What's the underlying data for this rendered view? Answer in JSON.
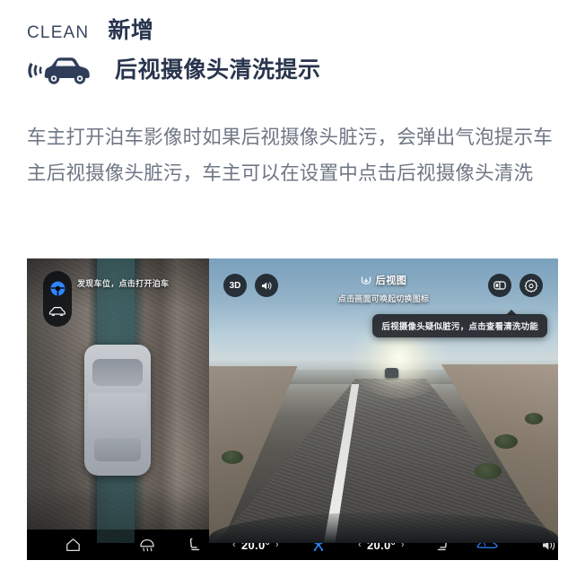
{
  "header": {
    "kicker": "CLEAN",
    "tag": "新增",
    "title": "后视摄像头清洗提示",
    "icon": "car-sonar-icon",
    "color": "#29354d"
  },
  "body": {
    "paragraph": "车主打开泊车影像时如果后视摄像头脏污，会弹出气泡提示车主后视摄像头脏污，车主可以在设置中点击后视摄像头清洗",
    "color": "#6f7785"
  },
  "screenshot": {
    "left_panel": {
      "hint_text": "发现车位，点击打开泊车",
      "controls": [
        {
          "name": "steering-wheel-icon",
          "color": "#2f86ff"
        },
        {
          "name": "car-top-icon",
          "color": "#ffffff"
        }
      ]
    },
    "right_panel": {
      "title": "后视图",
      "subtitle": "点击画面可唤起切换图标",
      "title_icon": "rear-view-icon",
      "buttons": [
        {
          "name": "3d-button",
          "label": "3D"
        },
        {
          "name": "volume-button",
          "label": ""
        },
        {
          "name": "split-view-button",
          "label": ""
        },
        {
          "name": "settings-button",
          "label": ""
        }
      ],
      "tooltip": "后视摄像头疑似脏污，点击查看清洗功能"
    },
    "bottom_bar": {
      "items": [
        {
          "name": "home-button",
          "label": ""
        },
        {
          "name": "defrost-button",
          "label": ""
        },
        {
          "name": "driver-seat-heat-button",
          "label": ""
        },
        {
          "name": "driver-temperature",
          "label": "20.0°"
        },
        {
          "name": "fan-auto-button",
          "label": "",
          "color": "#2f86ff"
        },
        {
          "name": "passenger-temperature",
          "label": "20.0°"
        },
        {
          "name": "passenger-seat-heat-button",
          "label": ""
        },
        {
          "name": "vehicle-button",
          "label": "",
          "color": "#2f86ff"
        },
        {
          "name": "volume-button",
          "label": ""
        }
      ],
      "chevron_left": "‹",
      "chevron_right": "›"
    }
  }
}
